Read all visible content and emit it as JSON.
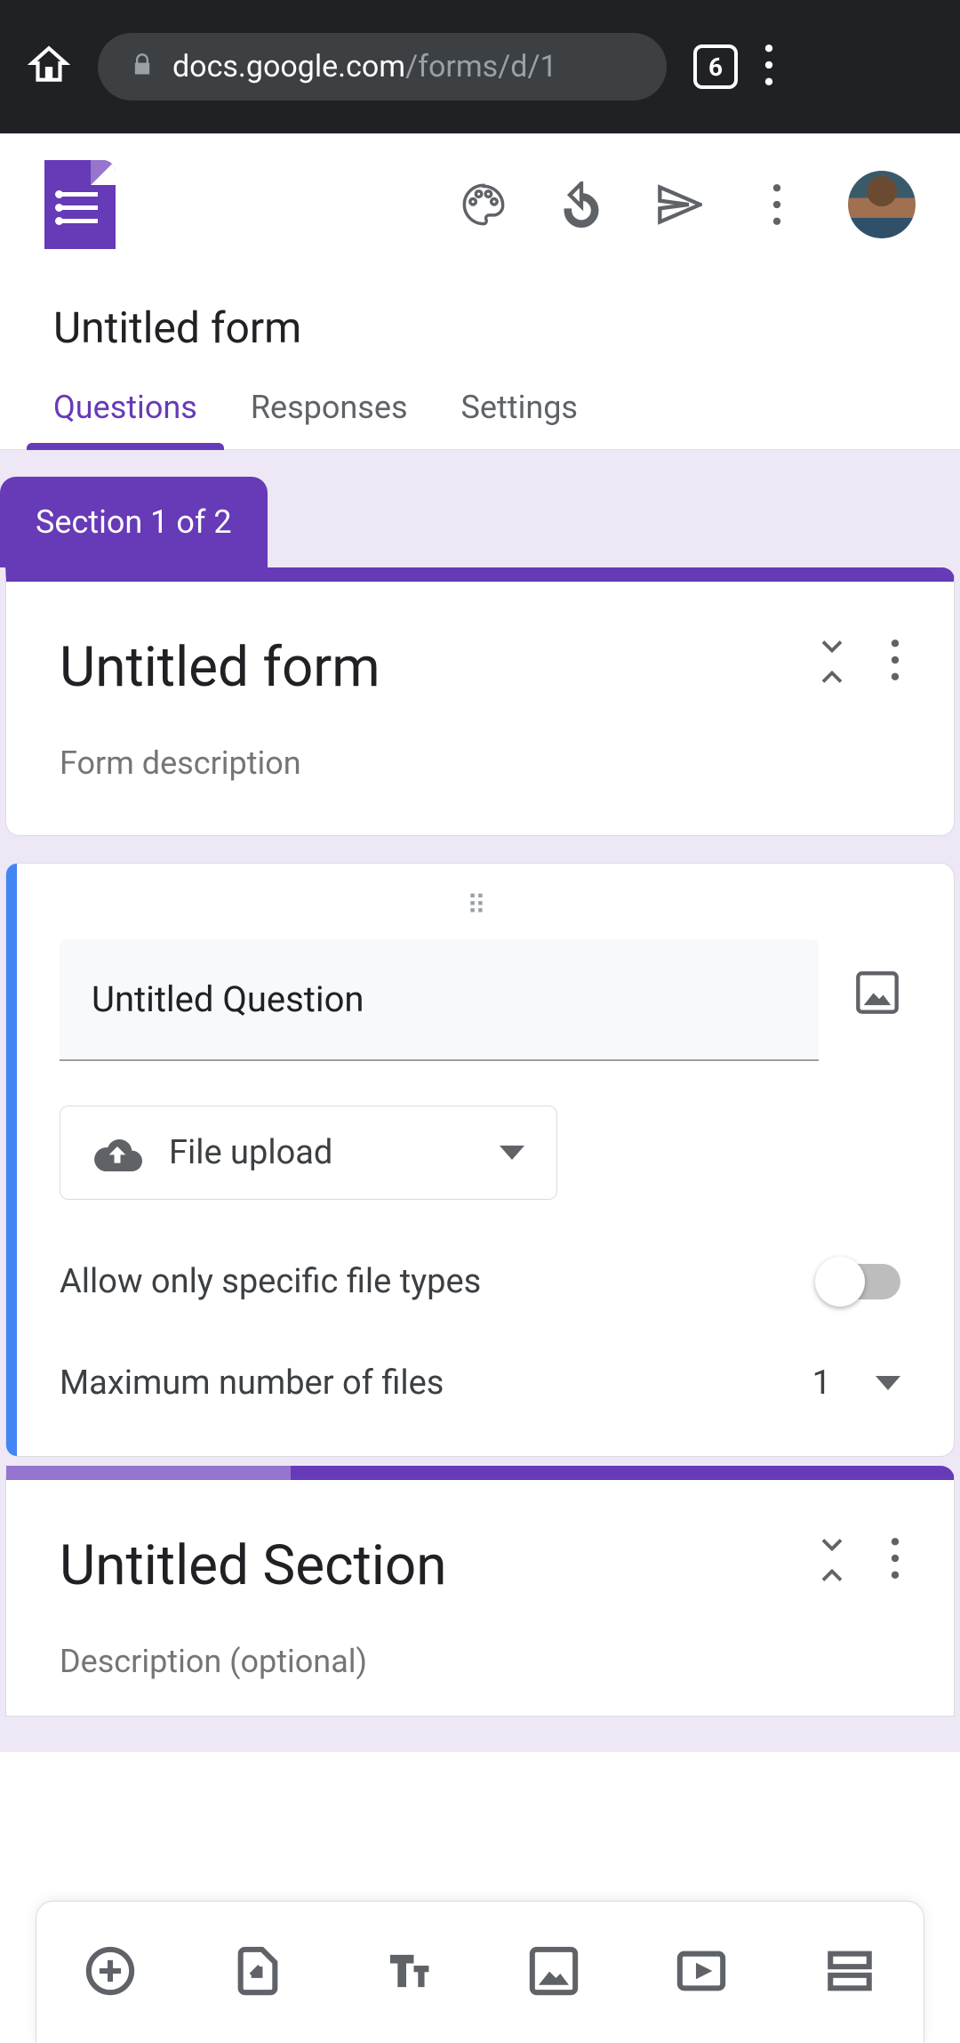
{
  "browser": {
    "url_domain": "docs.google.com",
    "url_path": "/forms/d/1",
    "tab_count": "6"
  },
  "app": {
    "form_title": "Untitled form",
    "tabs": [
      "Questions",
      "Responses",
      "Settings"
    ],
    "active_tab": 0
  },
  "section_header": {
    "section_label": "Section 1 of 2",
    "title": "Untitled form",
    "description_placeholder": "Form description"
  },
  "question": {
    "title_value": "Untitled Question",
    "type_label": "File upload",
    "allow_specific_label": "Allow only specific file types",
    "allow_specific_value": false,
    "max_files_label": "Maximum number of files",
    "max_files_value": "1"
  },
  "section2": {
    "title": "Untitled Section",
    "description_placeholder": "Description (optional)"
  },
  "toolbar_icons": [
    "add-question",
    "import-questions",
    "add-title",
    "add-image",
    "add-video",
    "add-section"
  ]
}
